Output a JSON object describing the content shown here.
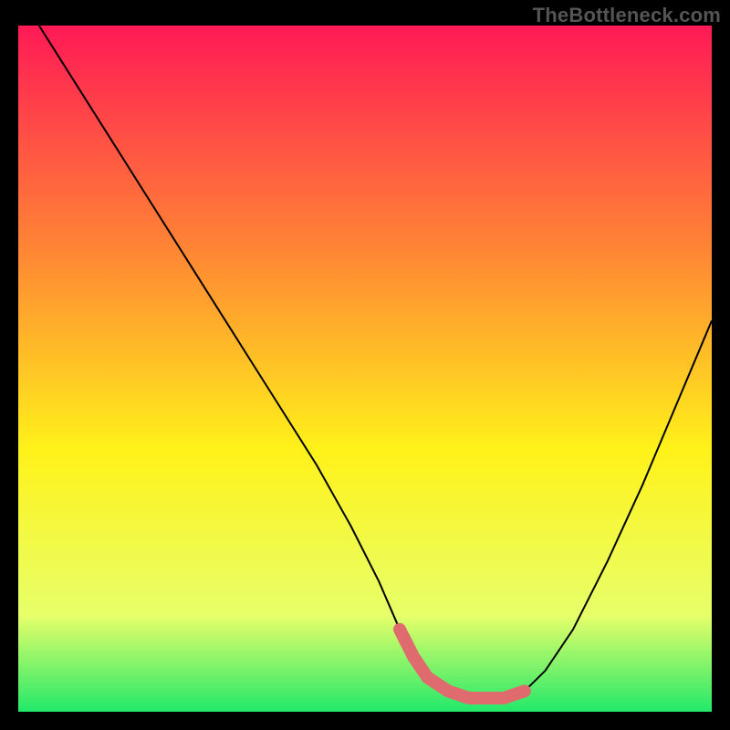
{
  "watermark": "TheBottleneck.com",
  "chart_data": {
    "type": "line",
    "title": "",
    "xlabel": "",
    "ylabel": "",
    "xlim": [
      0,
      100
    ],
    "ylim": [
      0,
      100
    ],
    "x": [
      3,
      8,
      13,
      18,
      23,
      28,
      33,
      38,
      43,
      48,
      52,
      55,
      57,
      59,
      62,
      65,
      70,
      73,
      76,
      80,
      85,
      90,
      95,
      100
    ],
    "values": [
      100,
      92,
      84,
      76,
      68,
      60,
      52,
      44,
      36,
      27,
      19,
      12,
      8,
      5,
      3,
      2,
      2,
      3,
      6,
      12,
      22,
      33,
      45,
      57
    ],
    "background_gradient": {
      "top": "#ff1a55",
      "mid_upper": "#ff8a33",
      "mid": "#fff21a",
      "mid_lower": "#e7ff6a",
      "bottom": "#22e86a"
    },
    "optimal_band": {
      "x_range": [
        55,
        73
      ],
      "color": "#e06b6e"
    }
  }
}
